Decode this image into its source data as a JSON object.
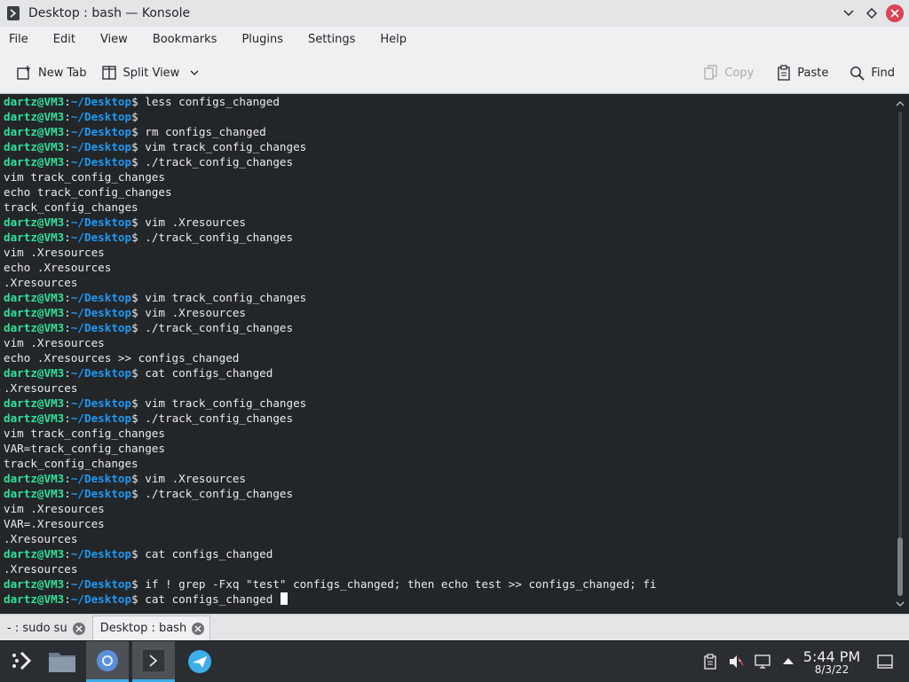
{
  "window": {
    "title": "Desktop : bash — Konsole"
  },
  "menu": [
    "File",
    "Edit",
    "View",
    "Bookmarks",
    "Plugins",
    "Settings",
    "Help"
  ],
  "toolbar": {
    "new_tab": "New Tab",
    "split_view": "Split View",
    "copy": "Copy",
    "paste": "Paste",
    "find": "Find"
  },
  "terminal": {
    "prompt_user": "dartz@VM3",
    "prompt_sep": ":",
    "prompt_path": "~/Desktop",
    "prompt_end": "$ ",
    "lines": [
      {
        "prompt": true,
        "text": "less configs_changed"
      },
      {
        "prompt": true,
        "text": ""
      },
      {
        "prompt": true,
        "text": "rm configs_changed"
      },
      {
        "prompt": true,
        "text": "vim track_config_changes"
      },
      {
        "prompt": true,
        "text": "./track_config_changes"
      },
      {
        "prompt": false,
        "text": "vim track_config_changes"
      },
      {
        "prompt": false,
        "text": "echo track_config_changes"
      },
      {
        "prompt": false,
        "text": "track_config_changes"
      },
      {
        "prompt": true,
        "text": "vim .Xresources"
      },
      {
        "prompt": true,
        "text": "./track_config_changes"
      },
      {
        "prompt": false,
        "text": "vim .Xresources"
      },
      {
        "prompt": false,
        "text": "echo .Xresources"
      },
      {
        "prompt": false,
        "text": ".Xresources"
      },
      {
        "prompt": true,
        "text": "vim track_config_changes"
      },
      {
        "prompt": true,
        "text": "vim .Xresources"
      },
      {
        "prompt": true,
        "text": "./track_config_changes"
      },
      {
        "prompt": false,
        "text": "vim .Xresources"
      },
      {
        "prompt": false,
        "text": "echo .Xresources >> configs_changed"
      },
      {
        "prompt": true,
        "text": "cat configs_changed"
      },
      {
        "prompt": false,
        "text": ".Xresources"
      },
      {
        "prompt": true,
        "text": "vim track_config_changes"
      },
      {
        "prompt": true,
        "text": "./track_config_changes"
      },
      {
        "prompt": false,
        "text": "vim track_config_changes"
      },
      {
        "prompt": false,
        "text": "VAR=track_config_changes"
      },
      {
        "prompt": false,
        "text": "track_config_changes"
      },
      {
        "prompt": true,
        "text": "vim .Xresources"
      },
      {
        "prompt": true,
        "text": "./track_config_changes"
      },
      {
        "prompt": false,
        "text": "vim .Xresources"
      },
      {
        "prompt": false,
        "text": "VAR=.Xresources"
      },
      {
        "prompt": false,
        "text": ".Xresources"
      },
      {
        "prompt": true,
        "text": "cat configs_changed"
      },
      {
        "prompt": false,
        "text": ".Xresources"
      },
      {
        "prompt": true,
        "text": "if ! grep -Fxq \"test\" configs_changed; then echo test >> configs_changed; fi"
      },
      {
        "prompt": true,
        "text": "cat configs_changed ",
        "cursor": true
      }
    ]
  },
  "tabs": [
    {
      "label": "- : sudo su"
    },
    {
      "label": "Desktop : bash"
    }
  ],
  "taskbar": {
    "clock_time": "5:44 PM",
    "clock_date": "8/3/22"
  },
  "colors": {
    "prompt_user": "#2ee09b",
    "prompt_path": "#1d99f3",
    "terminal_bg": "#232629",
    "accent": "#3daee9"
  }
}
